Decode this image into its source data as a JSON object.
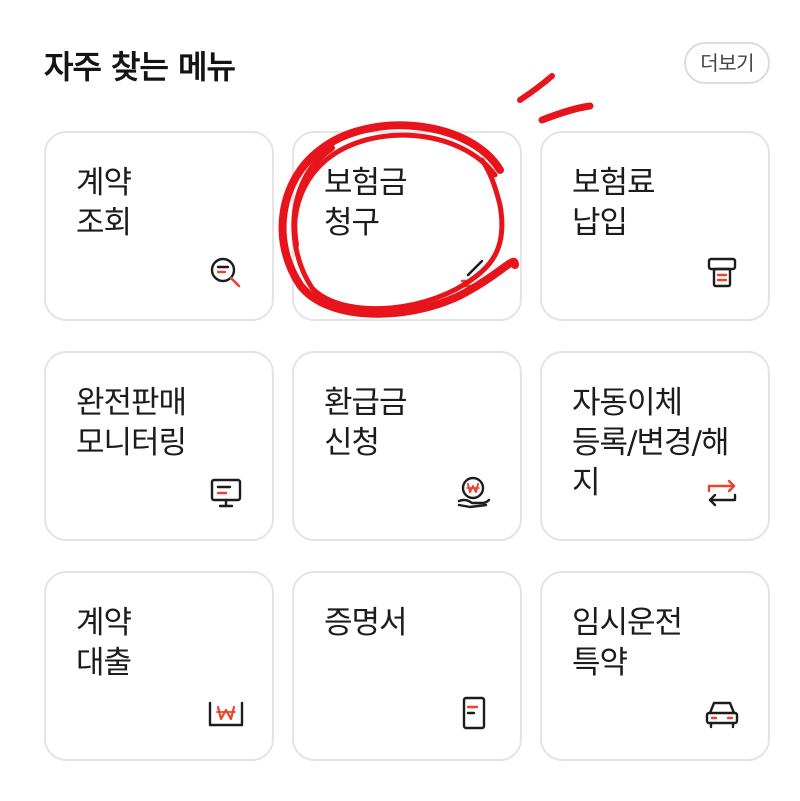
{
  "header": {
    "title": "자주 찾는 메뉴",
    "more_label": "더보기"
  },
  "menu": {
    "items": [
      {
        "label": "계약\n조회",
        "icon": "search-document-icon"
      },
      {
        "label": "보험금\n청구",
        "icon": "claim-document-icon"
      },
      {
        "label": "보험료\n납입",
        "icon": "payment-terminal-icon"
      },
      {
        "label": "완전판매\n모니터링",
        "icon": "monitor-icon"
      },
      {
        "label": "환급금\n신청",
        "icon": "refund-coin-hand-icon"
      },
      {
        "label": "자동이체\n등록/변경/해\n지",
        "icon": "auto-transfer-arrows-icon"
      },
      {
        "label": "계약\n대출",
        "icon": "loan-won-icon"
      },
      {
        "label": "증명서",
        "icon": "certificate-document-icon"
      },
      {
        "label": "임시운전\n특약",
        "icon": "car-icon"
      }
    ]
  },
  "colors": {
    "accent": "#e8442e",
    "annotation_red": "#e8141c",
    "card_border": "#e4e4e4",
    "text": "#1c1c1c"
  }
}
